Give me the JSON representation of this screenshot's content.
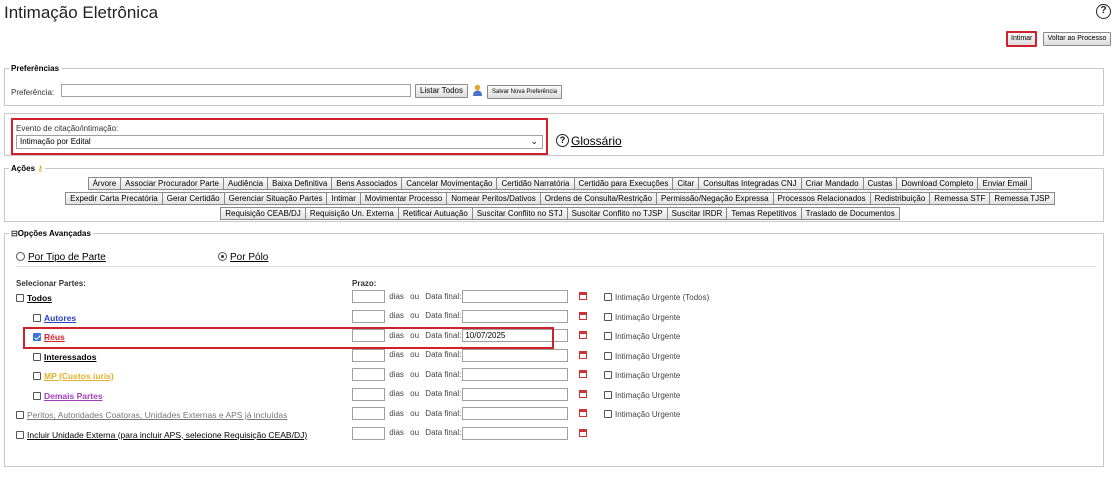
{
  "page": {
    "title": "Intimação Eletrônica"
  },
  "top_buttons": {
    "intimar": "Intimar",
    "voltar": "Voltar ao Processo"
  },
  "preferencias": {
    "legend": "Preferências",
    "label": "Preferência:",
    "value": "",
    "listar_todos": "Listar Todos",
    "salvar": "Salvar Nova Preferência"
  },
  "evento": {
    "label": "Evento de citação/intimação:",
    "selected": "Intimação por Edital",
    "glossario": "Glossário"
  },
  "acoes": {
    "legend": "Ações",
    "rows": [
      [
        "Árvore",
        "Associar Procurador Parte",
        "Audiência",
        "Baixa Definitiva",
        "Bens Associados",
        "Cancelar Movimentação",
        "Certidão Narratória",
        "Certidão para Execuções",
        "Citar",
        "Consultas Integradas CNJ",
        "Criar Mandado",
        "Custas",
        "Download Completo",
        "Enviar Email"
      ],
      [
        "Expedir Carta Precatória",
        "Gerar Certidão",
        "Gerenciar Situação Partes",
        "Intimar",
        "Movimentar Processo",
        "Nomear Peritos/Dativos",
        "Ordens de Consulta/Restrição",
        "Permissão/Negação Expressa",
        "Processos Relacionados",
        "Redistribuição",
        "Remessa STF",
        "Remessa TJSP"
      ],
      [
        "Requisição CEAB/DJ",
        "Requisição Un. Externa",
        "Retificar Autuação",
        "Suscitar Conflito no STJ",
        "Suscitar Conflito no TJSP",
        "Suscitar IRDR",
        "Temas Repetitivos",
        "Traslado de Documentos"
      ]
    ]
  },
  "opcoes": {
    "legend": "Opções Avançadas",
    "toggle": "⊟",
    "radio_tipo": "Por Tipo de Parte",
    "radio_polo": "Por Pólo",
    "selected_radio": "Por Pólo",
    "selecionar_partes": "Selecionar Partes:",
    "prazo": "Prazo:",
    "dias": "dias",
    "ou": "ou",
    "data_final": "Data final:",
    "parties": [
      {
        "label": "Todos",
        "checked": false,
        "color": "#000000",
        "date": "",
        "urgente": "Intimação Urgente (Todos)"
      },
      {
        "label": "Autores",
        "checked": false,
        "color": "#2a3fbf",
        "date": "",
        "urgente": "Intimação Urgente"
      },
      {
        "label": "Réus",
        "checked": true,
        "color": "#d0212b",
        "date": "10/07/2025",
        "urgente": "Intimação Urgente"
      },
      {
        "label": "Interessados",
        "checked": false,
        "color": "#000000",
        "date": "",
        "urgente": "Intimação Urgente"
      },
      {
        "label": "MP (Custos iuris)",
        "checked": false,
        "color": "#e0b22a",
        "date": "",
        "urgente": "Intimação Urgente"
      },
      {
        "label": "Demais Partes",
        "checked": false,
        "color": "#a13ec0",
        "date": "",
        "urgente": "Intimação Urgente"
      },
      {
        "label": "Peritos, Autoridades Coatoras, Unidades Externas e APS já incluídas",
        "checked": false,
        "color": "#777777",
        "date": "",
        "urgente": "Intimação Urgente"
      },
      {
        "label": "Incluir Unidade Externa (para incluir APS, selecione Requisição CEAB/DJ)",
        "checked": false,
        "color": "#000000",
        "date": "",
        "urgente": ""
      }
    ]
  },
  "colors": {
    "highlight": "#d0212b",
    "accent": "#3b75d6"
  },
  "icons": {
    "help": "question-circle-icon",
    "user": "user-icon",
    "calendar": "calendar-icon",
    "key": "key-icon"
  }
}
